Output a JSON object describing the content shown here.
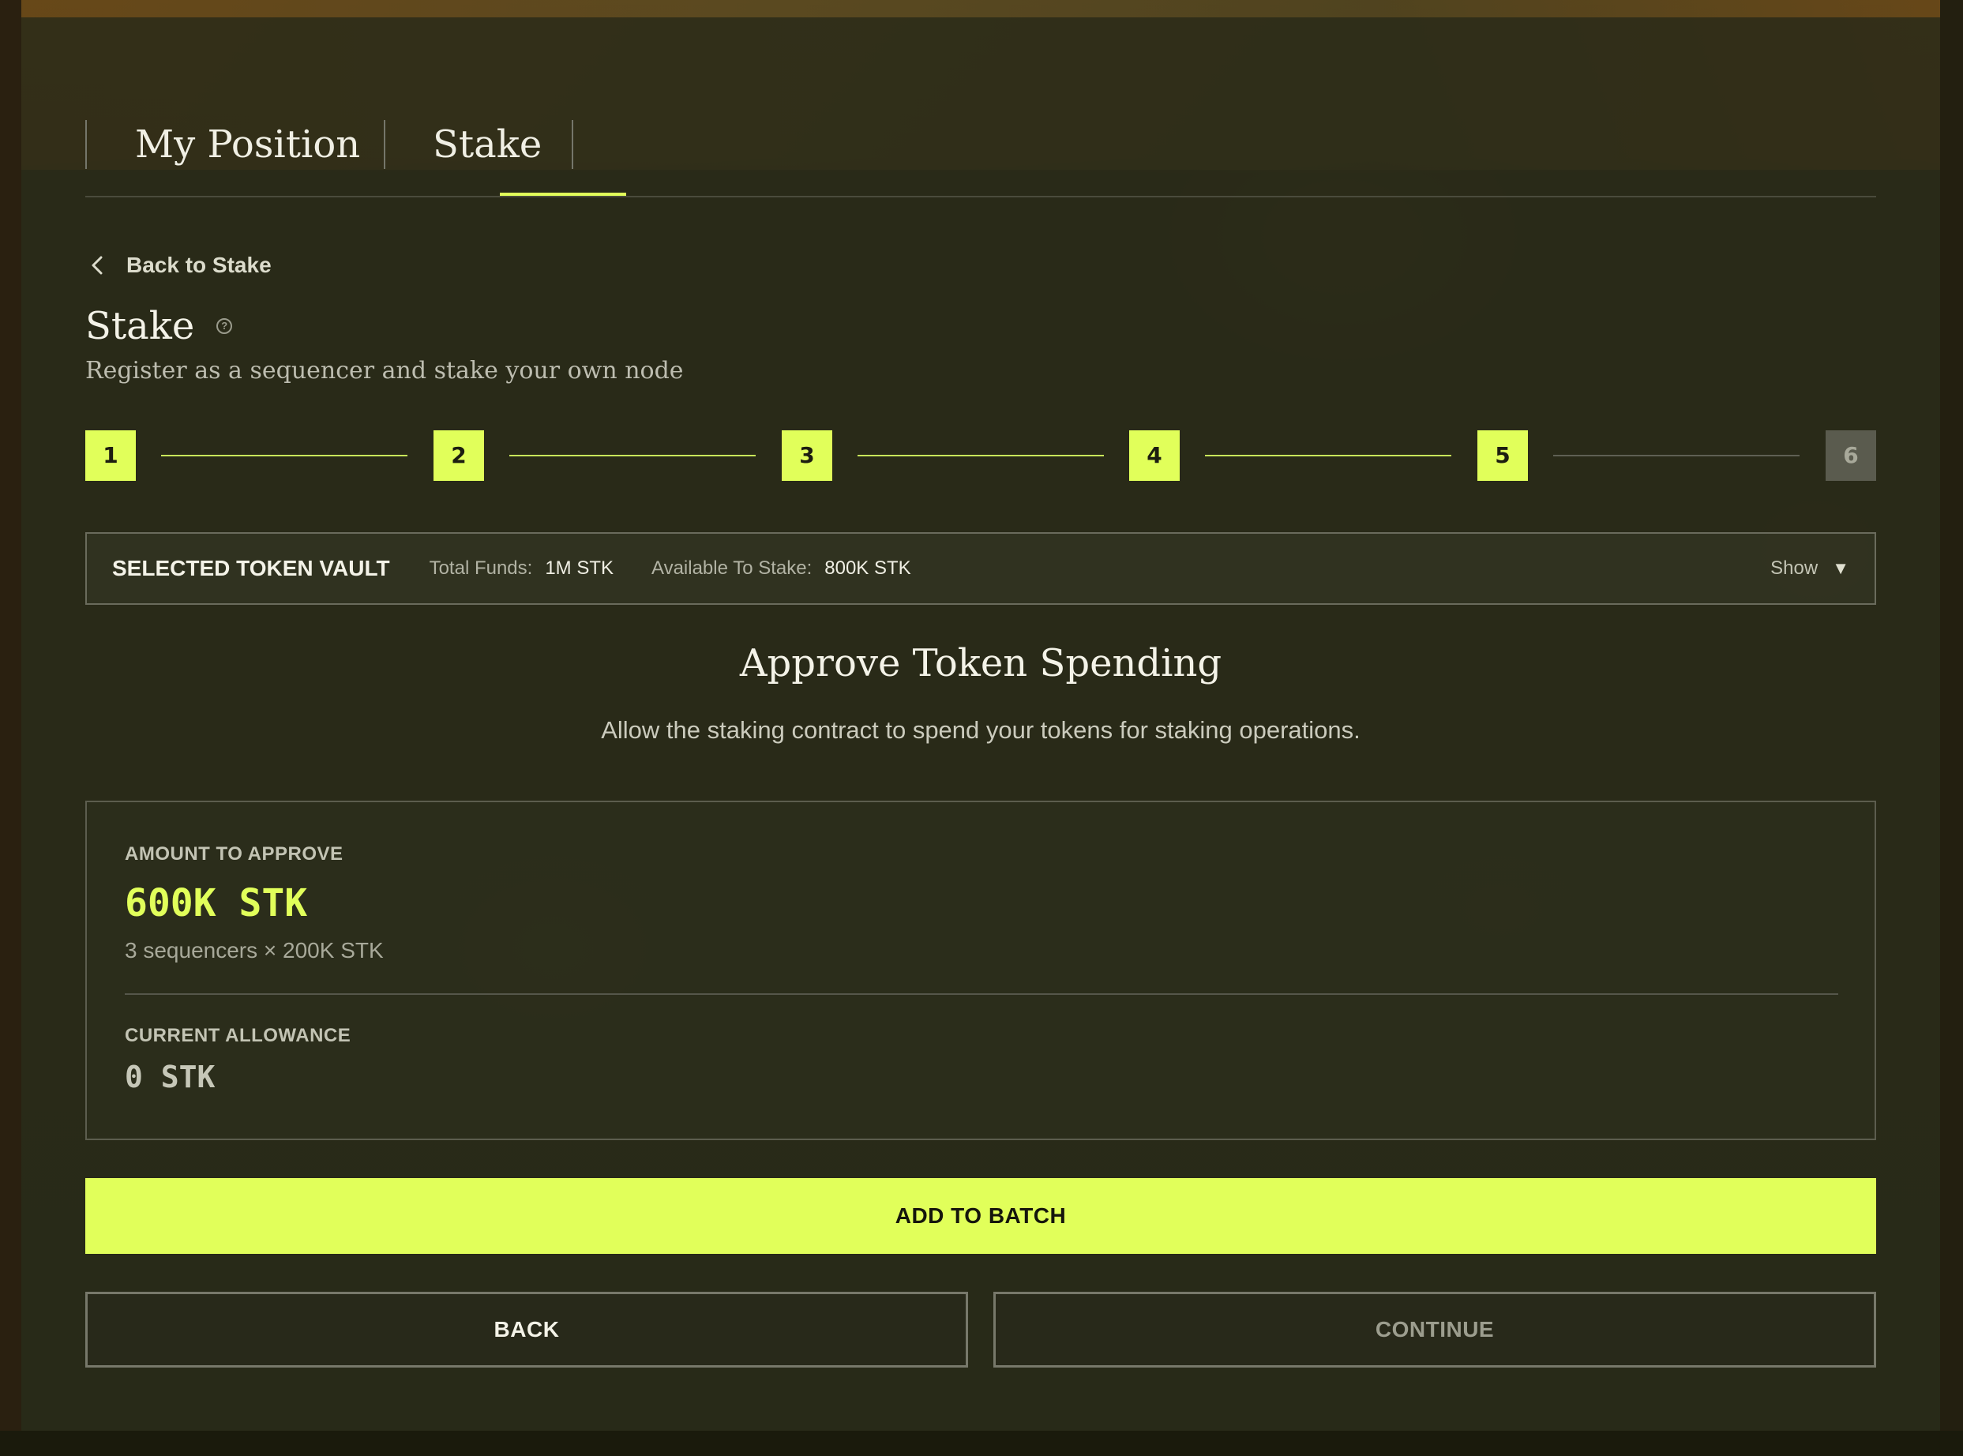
{
  "tabs": [
    {
      "label": "My Position",
      "active": false
    },
    {
      "label": "Stake",
      "active": true
    }
  ],
  "back_link": {
    "label": "Back to Stake",
    "icon": "chevron-left-icon"
  },
  "header": {
    "title": "Stake",
    "help_icon": "question-circle-icon",
    "subtitle": "Register as a sequencer and stake your own node"
  },
  "stepper": {
    "steps": [
      "1",
      "2",
      "3",
      "4",
      "5",
      "6"
    ],
    "current": 5,
    "active_color": "#e1ff5a",
    "inactive_color": "#5a5b4e"
  },
  "vault": {
    "title": "SELECTED TOKEN VAULT",
    "total_funds_label": "Total Funds:",
    "total_funds_value": "1M STK",
    "available_label": "Available To Stake:",
    "available_value": "800K STK",
    "toggle_label": "Show",
    "toggle_icon": "triangle-down-icon"
  },
  "approve": {
    "title": "Approve Token Spending",
    "description": "Allow the staking contract to spend your tokens for staking operations.",
    "amount_label": "AMOUNT TO APPROVE",
    "amount_value": "600K STK",
    "amount_breakdown": "3 sequencers × 200K STK",
    "allowance_label": "CURRENT ALLOWANCE",
    "allowance_value": "0 STK"
  },
  "actions": {
    "add_to_batch": "ADD TO BATCH",
    "back": "BACK",
    "continue": "CONTINUE"
  },
  "colors": {
    "accent": "#e1ff5a",
    "background": "#2b2c17"
  }
}
